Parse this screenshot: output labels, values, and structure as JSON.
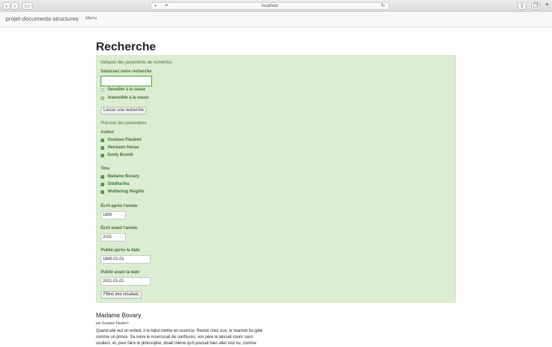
{
  "browser": {
    "url": "localhost"
  },
  "navbar": {
    "brand": "projet-documents-structures",
    "menu": "Menu"
  },
  "page": {
    "title": "Recherche"
  },
  "form": {
    "intro": "Indiquez des paramètres de recherche.",
    "search_label": "Saisissez votre recherche",
    "search_value": "",
    "case_sensitive": "Sensible à la casse",
    "case_insensitive": "Insensible à la casse",
    "launch_button": "Lancer une recherche",
    "params_hint": "Précisez des paramètres",
    "author_label": "Auteur",
    "authors": [
      "Gustave Flaubert",
      "Hermann Hesse",
      "Emily Brontë"
    ],
    "title_label": "Titre",
    "titles": [
      "Madame Bovary",
      "Siddhartha",
      "Wuthering Heights"
    ],
    "written_after_label": "Écrit après l'année",
    "written_after_value": "1800",
    "written_before_label": "Écrit avant l'année",
    "written_before_value": "2021",
    "published_after_label": "Publié après la date",
    "published_after_value": "1800-01-01",
    "published_before_label": "Publié avant la date",
    "published_before_value": "2021-01-01",
    "filter_button": "Filtrer des résultats"
  },
  "result": {
    "title": "Madame Bovary",
    "author": "par Gustave Flaubert",
    "excerpt": "Quand elle eut un enfant, il le fallut mettre en nourrice. Rentré chez eux, le marmot fut gâté comme un prince. Sa mère le nourrissait de confitures; son père le laissait courir sans souliers, et, pour faire le philosophe, disait même qu'il pouvait bien aller tout nu, comme"
  }
}
